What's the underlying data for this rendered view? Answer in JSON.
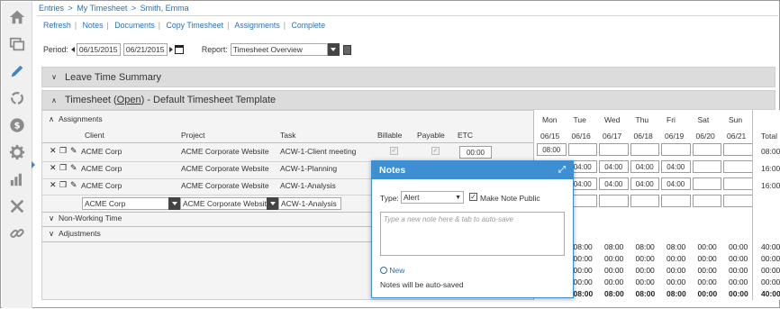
{
  "nav": {
    "icons": [
      "home-icon",
      "windows-icon",
      "pencil-icon",
      "refresh-icon",
      "dollar-icon",
      "gear-icon",
      "bar-chart-icon",
      "tools-icon",
      "link-icon"
    ],
    "active_color": "#3d87c9"
  },
  "breadcrumb": {
    "root": "Entries",
    "sep": ">",
    "page": "My Timesheet",
    "user": "Smith, Emma"
  },
  "actions": [
    "Refresh",
    "Notes",
    "Documents",
    "Copy Timesheet",
    "Assignments",
    "Complete"
  ],
  "period": {
    "label": "Period:",
    "start": "06/15/2015",
    "end": "06/21/2015"
  },
  "report": {
    "label": "Report:",
    "value": "Timesheet Overview"
  },
  "sections": {
    "leave": "Leave Time Summary",
    "timesheet_prefix": "Timesheet (",
    "timesheet_status": "Open",
    "timesheet_suffix": ")  - Default Timesheet Template"
  },
  "assignments": {
    "title": "Assignments",
    "columns": {
      "client": "Client",
      "project": "Project",
      "task": "Task",
      "billable": "Billable",
      "payable": "Payable",
      "etc": "ETC"
    },
    "rows": [
      {
        "client": "ACME Corp",
        "project": "ACME Corporate Website",
        "task": "ACW-1-Client meeting",
        "etc": "00:00",
        "days": [
          "08:00",
          "",
          "",
          "",
          "",
          "",
          ""
        ],
        "total": "08:00"
      },
      {
        "client": "ACME Corp",
        "project": "ACME Corporate Website",
        "task": "ACW-1-Planning",
        "etc": "",
        "days": [
          "",
          "04:00",
          "04:00",
          "04:00",
          "04:00",
          "",
          ""
        ],
        "total": "16:00"
      },
      {
        "client": "ACME Corp",
        "project": "ACME Corporate Website",
        "task": "ACW-1-Analysis",
        "etc": "",
        "days": [
          "",
          "04:00",
          "04:00",
          "04:00",
          "04:00",
          "",
          ""
        ],
        "total": "16:00"
      }
    ],
    "new_row": {
      "client": "ACME Corp",
      "project": "ACME Corporate Websit",
      "task": "ACW-1-Analysis"
    }
  },
  "days": {
    "names": [
      "Mon",
      "Tue",
      "Wed",
      "Thu",
      "Fri",
      "Sat",
      "Sun"
    ],
    "dates": [
      "06/15",
      "06/16",
      "06/17",
      "06/18",
      "06/19",
      "06/20",
      "06/21"
    ],
    "total_label": "Total"
  },
  "non_working": "Non-Working Time",
  "adjustments": "Adjustments",
  "summary_rows": [
    {
      "days": [
        "08:00",
        "08:00",
        "08:00",
        "08:00",
        "08:00",
        "00:00",
        "00:00"
      ],
      "total": "40:00"
    },
    {
      "days": [
        "00:00",
        "00:00",
        "00:00",
        "00:00",
        "00:00",
        "00:00",
        "00:00"
      ],
      "total": "00:00"
    },
    {
      "days": [
        "00:00",
        "00:00",
        "00:00",
        "00:00",
        "00:00",
        "00:00",
        "00:00"
      ],
      "total": "00:00"
    },
    {
      "days": [
        "00:00",
        "00:00",
        "00:00",
        "00:00",
        "00:00",
        "00:00",
        "00:00"
      ],
      "total": "00:00"
    },
    {
      "days": [
        "08:00",
        "08:00",
        "08:00",
        "08:00",
        "08:00",
        "00:00",
        "00:00"
      ],
      "total": "40:00"
    }
  ],
  "notes": {
    "title": "Notes",
    "type_label": "Type:",
    "type_value": "Alert",
    "public_label": "Make Note Public",
    "placeholder": "Type a new note here & tab to auto-save",
    "new_label": "New",
    "autosave": "Notes will be auto-saved",
    "accent": "#3d8fd1"
  }
}
